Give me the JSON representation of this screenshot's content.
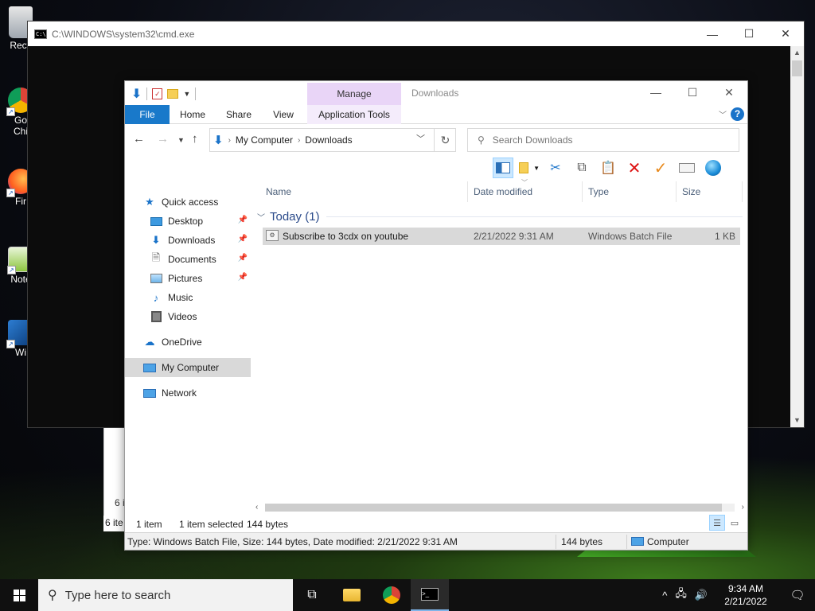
{
  "desktop": {
    "icons": [
      {
        "label": "Recy",
        "name": "recycle-bin"
      },
      {
        "label": "Go Chi",
        "line1": "Go",
        "line2": "Chi",
        "name": "google-chrome"
      },
      {
        "label": "Fir",
        "name": "firefox"
      },
      {
        "label": "Note",
        "name": "notepad-plus-plus"
      },
      {
        "label": "Wi",
        "name": "winscp"
      }
    ]
  },
  "cmd": {
    "title": "C:\\WINDOWS\\system32\\cmd.exe",
    "icon_text": "C:\\"
  },
  "background_explorer": {
    "status1": "6 i",
    "status2": "6 ite"
  },
  "explorer": {
    "title": "Downloads",
    "manage_label": "Manage",
    "tabs": {
      "file": "File",
      "home": "Home",
      "share": "Share",
      "view": "View",
      "app_tools": "Application Tools"
    },
    "help": "?",
    "address": {
      "root": "My Computer",
      "current": "Downloads"
    },
    "search": {
      "placeholder": "Search Downloads"
    },
    "nav": {
      "quick_access": "Quick access",
      "desktop": "Desktop",
      "downloads": "Downloads",
      "documents": "Documents",
      "pictures": "Pictures",
      "music": "Music",
      "videos": "Videos",
      "onedrive": "OneDrive",
      "my_computer": "My Computer",
      "network": "Network"
    },
    "columns": {
      "name": "Name",
      "date": "Date modified",
      "type": "Type",
      "size": "Size"
    },
    "group": {
      "title": "Today (1)"
    },
    "file": {
      "name": "Subscribe to 3cdx on youtube",
      "date": "2/21/2022 9:31 AM",
      "type": "Windows Batch File",
      "size": "1 KB"
    },
    "status": {
      "count": "1 item",
      "selected": "1 item selected",
      "bytes": "144 bytes"
    },
    "statusbar": {
      "details": "Type: Windows Batch File, Size: 144 bytes, Date modified: 2/21/2022 9:31 AM",
      "size": "144 bytes",
      "location": "Computer"
    }
  },
  "taskbar": {
    "search_placeholder": "Type here to search",
    "time": "9:34 AM",
    "date": "2/21/2022"
  },
  "colors": {
    "file_tab": "#1979ca",
    "manage_tab": "#e9d5f7",
    "selection": "#d9d9d9",
    "taskbar": "#101010"
  }
}
